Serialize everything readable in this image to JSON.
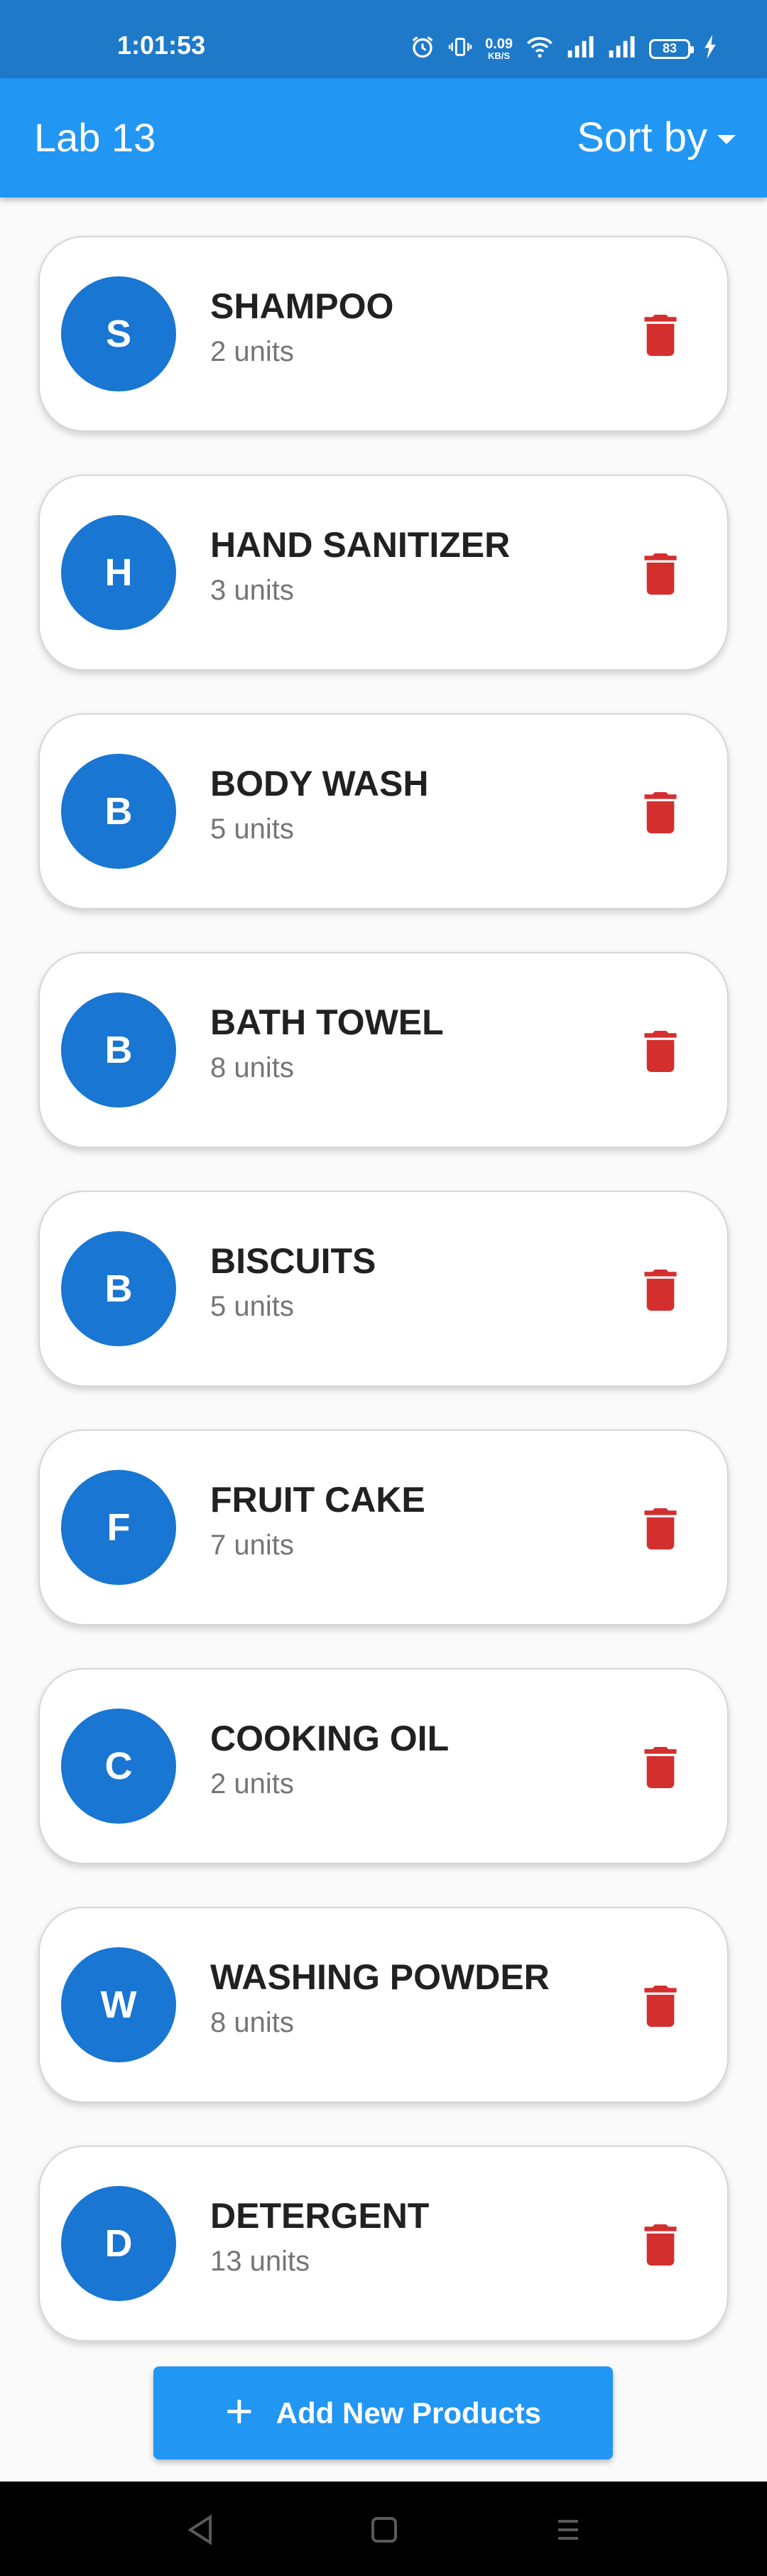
{
  "status_bar": {
    "time": "1:01:53",
    "net_speed": "0.09",
    "net_unit": "KB/S",
    "battery": "83"
  },
  "app_bar": {
    "title": "Lab 13",
    "sort_label": "Sort by"
  },
  "products": [
    {
      "initial": "S",
      "name": "SHAMPOO",
      "units": "2 units"
    },
    {
      "initial": "H",
      "name": "HAND SANITIZER",
      "units": "3 units"
    },
    {
      "initial": "B",
      "name": "BODY WASH",
      "units": "5 units"
    },
    {
      "initial": "B",
      "name": "BATH TOWEL",
      "units": "8 units"
    },
    {
      "initial": "B",
      "name": "BISCUITS",
      "units": "5 units"
    },
    {
      "initial": "F",
      "name": "FRUIT CAKE",
      "units": "7 units"
    },
    {
      "initial": "C",
      "name": "COOKING OIL",
      "units": "2 units"
    },
    {
      "initial": "W",
      "name": "WASHING POWDER",
      "units": "8 units"
    },
    {
      "initial": "D",
      "name": "DETERGENT",
      "units": "13 units"
    }
  ],
  "add_button": {
    "label": "Add New Products"
  },
  "colors": {
    "primary": "#2196f3",
    "status_bar": "#1e79c9",
    "avatar": "#1976d2",
    "delete": "#d32f2f"
  },
  "icons": {
    "delete": "trash-icon",
    "add": "plus-icon",
    "sort": "caret-down-icon",
    "nav_back": "triangle-back-icon",
    "nav_home": "square-home-icon",
    "nav_recents": "menu-lines-icon"
  }
}
